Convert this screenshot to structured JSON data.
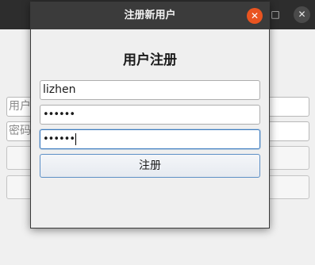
{
  "background_window": {
    "minimize_icon": "□",
    "close_icon": "✕",
    "username_placeholder": "用户",
    "password_placeholder": "密码"
  },
  "dialog": {
    "title": "注册新用户",
    "close_icon": "✕",
    "heading": "用户注册",
    "username_value": "lizhen",
    "password_value": "••••••",
    "confirm_password_value": "••••••",
    "register_label": "注册"
  },
  "colors": {
    "close_button": "#e95420",
    "focus_border": "#3c7bbf",
    "titlebar": "#3b3b3b"
  }
}
